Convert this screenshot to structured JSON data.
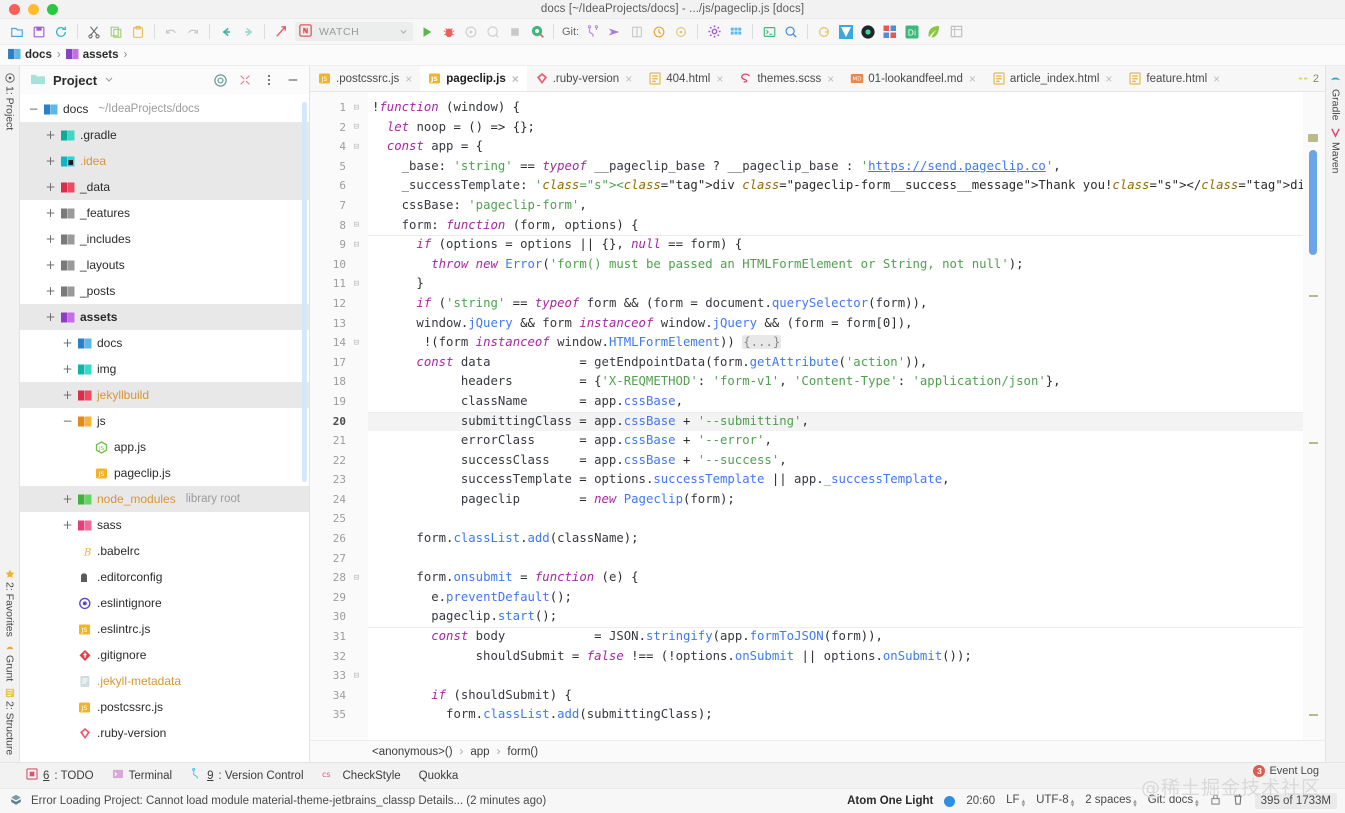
{
  "window": {
    "title": "docs [~/IdeaProjects/docs] - .../js/pageclip.js [docs]"
  },
  "toolbar": {
    "run_config": "WATCH",
    "git_label": "Git:"
  },
  "navbar": {
    "crumbs": [
      "docs",
      "assets"
    ],
    "separator": "›"
  },
  "project_panel": {
    "title": "Project",
    "tree": [
      {
        "indent": 0,
        "toggle": "−",
        "icon": "module",
        "label": "docs",
        "bold": false,
        "hint": "~/IdeaProjects/docs",
        "selected": false
      },
      {
        "indent": 1,
        "toggle": "+",
        "icon": "gradle",
        "label": ".gradle",
        "bold": false,
        "hint": "",
        "selected": true
      },
      {
        "indent": 1,
        "toggle": "+",
        "icon": "idea",
        "label": ".idea",
        "bold": false,
        "hint": "",
        "selected": true,
        "orange": true
      },
      {
        "indent": 1,
        "toggle": "+",
        "icon": "red",
        "label": "_data",
        "bold": false,
        "hint": "",
        "selected": true
      },
      {
        "indent": 1,
        "toggle": "+",
        "icon": "gray",
        "label": "_features",
        "bold": false,
        "hint": "",
        "selected": false
      },
      {
        "indent": 1,
        "toggle": "+",
        "icon": "gray",
        "label": "_includes",
        "bold": false,
        "hint": "",
        "selected": false
      },
      {
        "indent": 1,
        "toggle": "+",
        "icon": "gray",
        "label": "_layouts",
        "bold": false,
        "hint": "",
        "selected": false
      },
      {
        "indent": 1,
        "toggle": "+",
        "icon": "gray",
        "label": "_posts",
        "bold": false,
        "hint": "",
        "selected": false
      },
      {
        "indent": 1,
        "toggle": "+",
        "icon": "purple",
        "label": "assets",
        "bold": true,
        "hint": "",
        "selected": true
      },
      {
        "indent": 2,
        "toggle": "+",
        "icon": "module",
        "label": "docs",
        "bold": false,
        "hint": "",
        "selected": false
      },
      {
        "indent": 2,
        "toggle": "+",
        "icon": "teal",
        "label": "img",
        "bold": false,
        "hint": "",
        "selected": false
      },
      {
        "indent": 2,
        "toggle": "+",
        "icon": "red",
        "label": "jekyllbuild",
        "bold": false,
        "hint": "",
        "selected": true,
        "orange": true
      },
      {
        "indent": 2,
        "toggle": "−",
        "icon": "orange",
        "label": "js",
        "bold": false,
        "hint": "",
        "selected": false
      },
      {
        "indent": 3,
        "toggle": "",
        "icon": "js-green",
        "label": "app.js",
        "bold": false,
        "hint": "",
        "selected": false
      },
      {
        "indent": 3,
        "toggle": "",
        "icon": "js",
        "label": "pageclip.js",
        "bold": false,
        "hint": "",
        "selected": false
      },
      {
        "indent": 2,
        "toggle": "+",
        "icon": "green",
        "label": "node_modules",
        "bold": false,
        "hint": "library root",
        "selected": true,
        "orange": true
      },
      {
        "indent": 2,
        "toggle": "+",
        "icon": "pink",
        "label": "sass",
        "bold": false,
        "hint": "",
        "selected": false
      },
      {
        "indent": 2,
        "toggle": "",
        "icon": "babel",
        "label": ".babelrc",
        "bold": false,
        "hint": "",
        "selected": false
      },
      {
        "indent": 2,
        "toggle": "",
        "icon": "editorconfig",
        "label": ".editorconfig",
        "bold": false,
        "hint": "",
        "selected": false
      },
      {
        "indent": 2,
        "toggle": "",
        "icon": "eslint",
        "label": ".eslintignore",
        "bold": false,
        "hint": "",
        "selected": false
      },
      {
        "indent": 2,
        "toggle": "",
        "icon": "js",
        "label": ".eslintrc.js",
        "bold": false,
        "hint": "",
        "selected": false
      },
      {
        "indent": 2,
        "toggle": "",
        "icon": "git",
        "label": ".gitignore",
        "bold": false,
        "hint": "",
        "selected": false
      },
      {
        "indent": 2,
        "toggle": "",
        "icon": "doc",
        "label": ".jekyll-metadata",
        "bold": false,
        "hint": "",
        "selected": false,
        "orange": true
      },
      {
        "indent": 2,
        "toggle": "",
        "icon": "js",
        "label": ".postcssrc.js",
        "bold": false,
        "hint": "",
        "selected": false
      },
      {
        "indent": 2,
        "toggle": "",
        "icon": "ruby",
        "label": ".ruby-version",
        "bold": false,
        "hint": "",
        "selected": false
      }
    ]
  },
  "left_strip": {
    "top_items": [
      "1: Project"
    ],
    "bottom_items": [
      "2: Structure",
      "Grunt",
      "2: Favorites"
    ]
  },
  "right_strip": {
    "items": [
      "Gradle",
      "Maven"
    ]
  },
  "editor": {
    "tabs": [
      {
        "label": ".postcssrc.js",
        "icon": "js",
        "active": false
      },
      {
        "label": "pageclip.js",
        "icon": "js",
        "active": true
      },
      {
        "label": ".ruby-version",
        "icon": "ruby",
        "active": false
      },
      {
        "label": "404.html",
        "icon": "html",
        "active": false
      },
      {
        "label": "themes.scss",
        "icon": "sass",
        "active": false
      },
      {
        "label": "01-lookandfeel.md",
        "icon": "md",
        "active": false
      },
      {
        "label": "article_index.html",
        "icon": "html",
        "active": false
      },
      {
        "label": "feature.html",
        "icon": "html",
        "active": false
      }
    ],
    "warning_count": "2",
    "close_glyph": "×",
    "line_numbers": [
      "1",
      "2",
      "4",
      "5",
      "6",
      "7",
      "8",
      "9",
      "10",
      "11",
      "12",
      "13",
      "14",
      "17",
      "18",
      "19",
      "20",
      "21",
      "22",
      "23",
      "24",
      "25",
      "26",
      "27",
      "28",
      "29",
      "30",
      "31",
      "32",
      "33",
      "34",
      "35"
    ],
    "current_line": "20",
    "code_lines": [
      "!function (window) {",
      "  let noop = () => {};",
      "  const app = {",
      "    _base: 'string' == typeof __pageclip_base ? __pageclip_base : 'https://send.pageclip.co',",
      "    _successTemplate: '<div class=\"pageclip-form__success__message\">Thank you!</div>',",
      "    cssBase: 'pageclip-form',",
      "    form: function (form, options) {",
      "      if (options = options || {}, null == form) {",
      "        throw new Error('form() must be passed an HTMLFormElement or String, not null');",
      "      }",
      "      if ('string' == typeof form && (form = document.querySelector(form)),",
      "      window.jQuery && form instanceof window.jQuery && (form = form[0]),",
      "       !(form instanceof window.HTMLFormElement)) {...}",
      "      const data            = getEndpointData(form.getAttribute('action')),",
      "            headers         = {'X-REQMETHOD': 'form-v1', 'Content-Type': 'application/json'},",
      "            className       = app.cssBase,",
      "            submittingClass = app.cssBase + '--submitting',",
      "            errorClass      = app.cssBase + '--error',",
      "            successClass    = app.cssBase + '--success',",
      "            successTemplate = options.successTemplate || app._successTemplate,",
      "            pageclip        = new Pageclip(form);",
      "",
      "      form.classList.add(className);",
      "",
      "      form.onsubmit = function (e) {",
      "        e.preventDefault();",
      "        pageclip.start();",
      "        const body            = JSON.stringify(app.formToJSON(form)),",
      "              shouldSubmit = false !== (!options.onSubmit || options.onSubmit());",
      "",
      "        if (shouldSubmit) {",
      "          form.classList.add(submittingClass);"
    ],
    "breadcrumbs": [
      "<anonymous>()",
      "app",
      "form()"
    ],
    "breadcrumb_separator": "›"
  },
  "bottom_bar": {
    "items": [
      {
        "num": "6",
        "label": ": TODO",
        "icon": "todo-icon"
      },
      {
        "num": "",
        "label": "Terminal",
        "icon": "terminal-icon"
      },
      {
        "num": "9",
        "label": ": Version Control",
        "icon": "vcs-icon"
      },
      {
        "num": "",
        "label": "CheckStyle",
        "icon": "checkstyle-icon"
      },
      {
        "num": "",
        "label": "Quokka",
        "icon": "quokka-icon"
      }
    ]
  },
  "status_bar": {
    "error_message": "Error Loading Project: Cannot load module material-theme-jetbrains_classp Details... (2 minutes ago)",
    "theme": "Atom One Light",
    "caret_position": "20:60",
    "line_separator": "LF",
    "encoding": "UTF-8",
    "indent": "2 spaces",
    "git_branch": "Git: docs",
    "memory": "395 of 1733M",
    "event_log_label": "Event Log",
    "event_log_count": "3",
    "watermark": "@稀土掘金技术社区"
  },
  "colors": {
    "accent_blue": "#4078f2",
    "string_green": "#50a14f",
    "keyword_purple": "#a626a4",
    "property_gold": "#986801",
    "tag_red": "#e45649",
    "selection_gray": "#e8e8e8"
  }
}
